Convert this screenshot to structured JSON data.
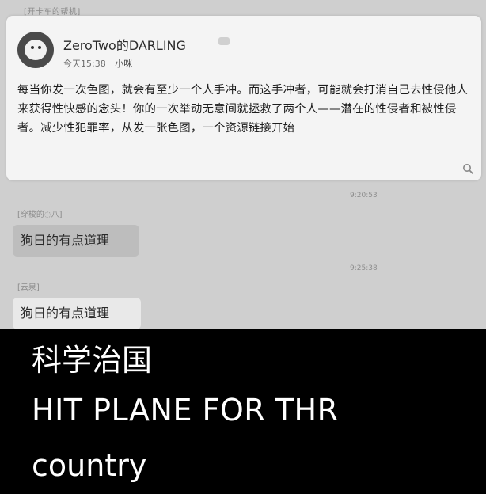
{
  "chat": {
    "top_label": "[开卡车的帮机]",
    "post": {
      "author": "ZeroTwo的DARLING",
      "time": "今天15:38",
      "meta_extra": "小咪",
      "text": "每当你发一次色图，就会有至少一个人手冲。而这手冲者，可能就会打消自己去性侵他人来获得性快感的念头！你的一次举动无意间就拯救了两个人——潜在的性侵者和被性侵者。减少性犯罪率，从发一张色图，一个资源链接开始"
    },
    "messages": [
      {
        "timestamp": "9:20:53",
        "sender": "[穿梭的◌八]",
        "text": "狗日的有点道理"
      },
      {
        "timestamp": "9:25:38",
        "sender": "[云泉]",
        "text": "狗日的有点道理"
      }
    ]
  },
  "caption": {
    "line1": "科学治国",
    "line2": "HIT PLANE FOR THR",
    "line3": "country"
  }
}
